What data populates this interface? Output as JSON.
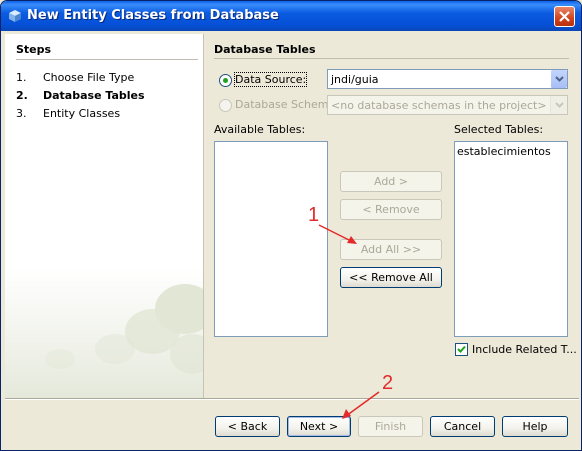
{
  "window": {
    "title": "New Entity Classes from Database"
  },
  "steps": {
    "title": "Steps",
    "items": [
      {
        "num": "1.",
        "label": "Choose File Type"
      },
      {
        "num": "2.",
        "label": "Database Tables"
      },
      {
        "num": "3.",
        "label": "Entity Classes"
      }
    ]
  },
  "panel": {
    "title": "Database Tables",
    "data_source_label": "Data Source:",
    "data_source_value": "jndi/guia",
    "schema_label": "Database Schema",
    "schema_value": "<no database schemas in the project>",
    "available_label": "Available Tables:",
    "selected_label": "Selected Tables:",
    "available_tables": [],
    "selected_tables": [
      "establecimientos"
    ],
    "include_related_label": "Include Related T..."
  },
  "buttons": {
    "add": "Add >",
    "remove": "< Remove",
    "add_all": "Add All >>",
    "remove_all": "<< Remove All"
  },
  "footer": {
    "back": "< Back",
    "next": "Next >",
    "finish": "Finish",
    "cancel": "Cancel",
    "help": "Help"
  },
  "annotations": {
    "one": "1",
    "two": "2"
  },
  "colors": {
    "annotation": "#e32b2b",
    "title_bar": "#0550d6"
  }
}
